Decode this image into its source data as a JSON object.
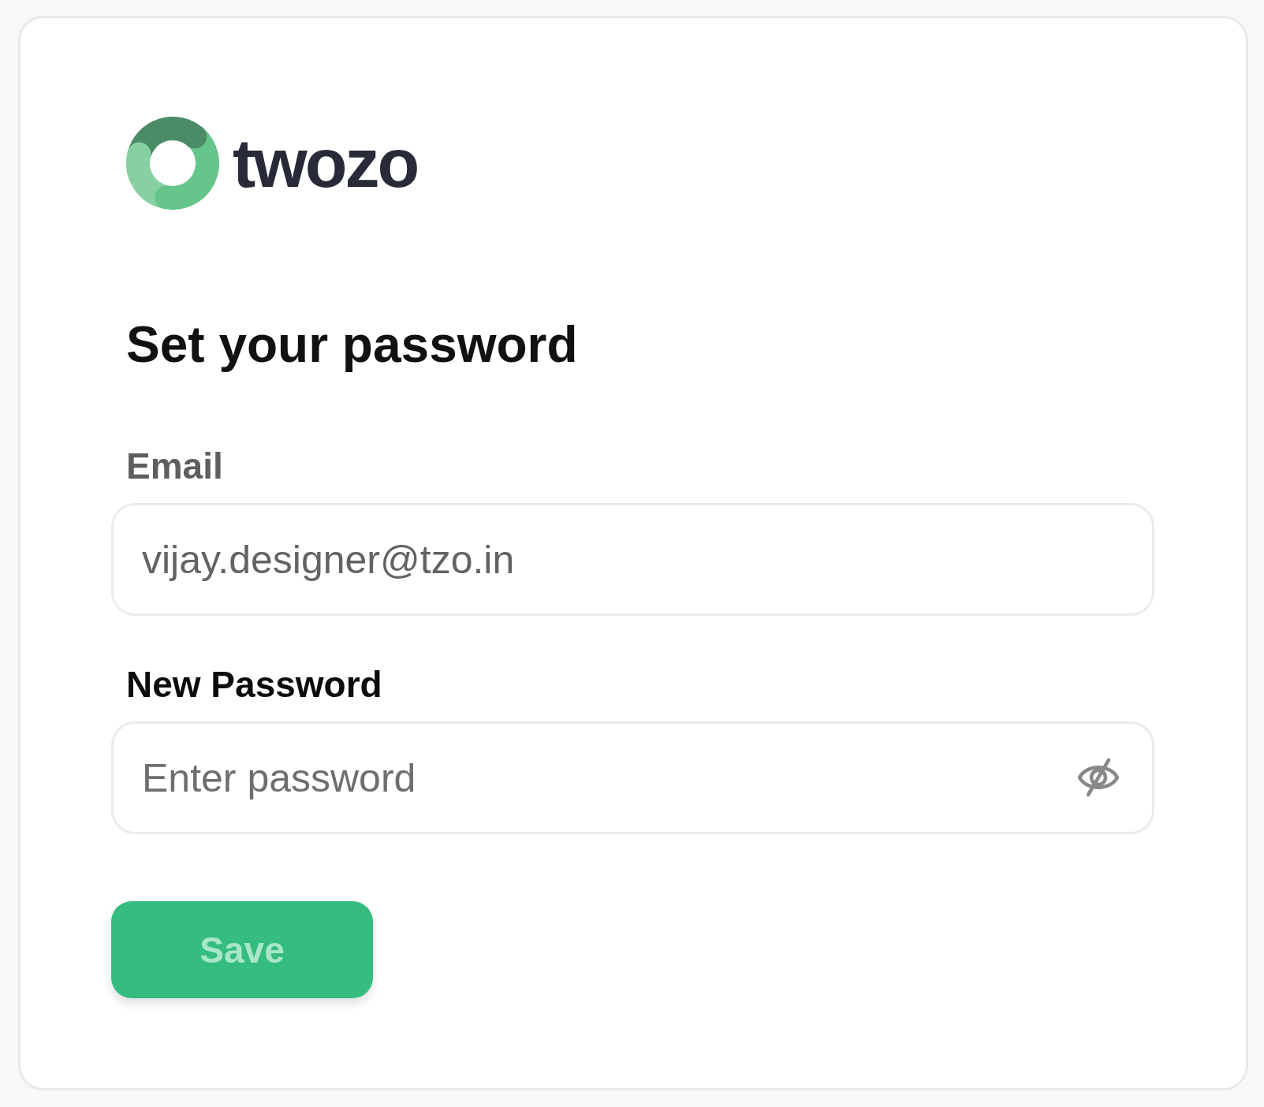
{
  "logo": {
    "wordmark": "twozo"
  },
  "heading": "Set your password",
  "fields": [
    {
      "kind": "email",
      "label": "Email",
      "value": "vijay.designer@tzo.in",
      "disabled": true
    },
    {
      "kind": "password",
      "label": "New Password",
      "placeholder": "Enter password",
      "disabled": false,
      "revealed": false
    }
  ],
  "save_button": {
    "label": "Save",
    "disabled": true
  }
}
